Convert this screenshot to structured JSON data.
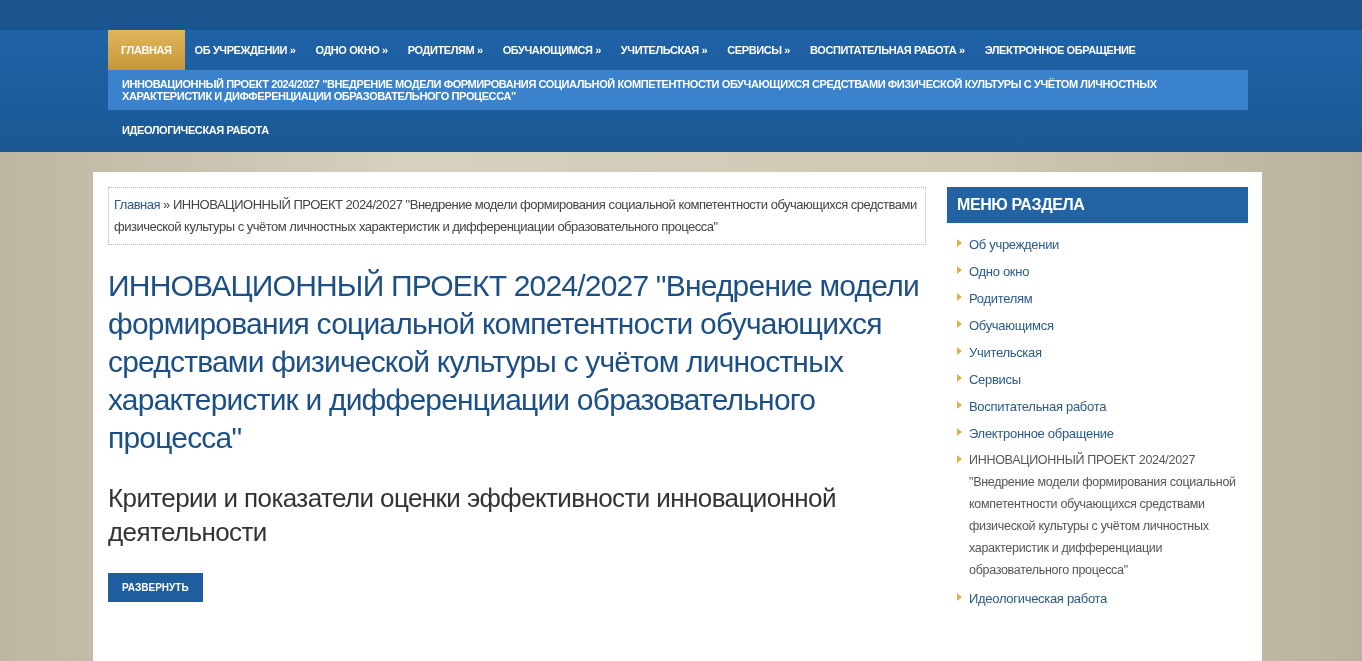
{
  "nav": {
    "items": [
      {
        "label": "ГЛАВНАЯ",
        "selected": true,
        "current": false
      },
      {
        "label": "ОБ УЧРЕЖДЕНИИ »",
        "selected": false,
        "current": false
      },
      {
        "label": "ОДНО ОКНО »",
        "selected": false,
        "current": false
      },
      {
        "label": "РОДИТЕЛЯМ »",
        "selected": false,
        "current": false
      },
      {
        "label": "ОБУЧАЮЩИМСЯ »",
        "selected": false,
        "current": false
      },
      {
        "label": "УЧИТЕЛЬСКАЯ »",
        "selected": false,
        "current": false
      },
      {
        "label": "СЕРВИСЫ »",
        "selected": false,
        "current": false
      },
      {
        "label": "ВОСПИТАТЕЛЬНАЯ РАБОТА »",
        "selected": false,
        "current": false
      },
      {
        "label": "ЭЛЕКТРОННОЕ ОБРАЩЕНИЕ",
        "selected": false,
        "current": false
      },
      {
        "label": "ИННОВАЦИОННЫЙ ПРОЕКТ 2024/2027 \"ВНЕДРЕНИЕ МОДЕЛИ ФОРМИРОВАНИЯ СОЦИАЛЬНОЙ КОМПЕТЕНТНОСТИ ОБУЧАЮЩИХСЯ СРЕДСТВАМИ ФИЗИЧЕСКОЙ КУЛЬТУРЫ С УЧЁТОМ ЛИЧНОСТНЫХ ХАРАКТЕРИСТИК И ДИФФЕРЕНЦИАЦИИ ОБРАЗОВАТЕЛЬНОГО ПРОЦЕССА\"",
        "selected": false,
        "current": true
      },
      {
        "label": "ИДЕОЛОГИЧЕСКАЯ РАБОТА",
        "selected": false,
        "current": false
      }
    ]
  },
  "breadcrumb": {
    "link": "Главная",
    "separator": "»",
    "current": "ИННОВАЦИОННЫЙ ПРОЕКТ 2024/2027 \"Внедрение модели формирования социальной компетентности обучающихся средствами физической культуры с учётом личностных характеристик и дифференциации образовательного процесса\""
  },
  "page_title": "ИННОВАЦИОННЫЙ ПРОЕКТ 2024/2027 \"Внедрение модели формирования социальной компетентности обучающихся средствами физической культуры с учётом личностных характеристик и дифференциации образовательного процесса\"",
  "section_heading": "Критерии и показатели оценки эффективности инновационной деятельности",
  "expand_button": "РАЗВЕРНУТЬ",
  "sidebar": {
    "title": "МЕНЮ РАЗДЕЛА",
    "items": [
      {
        "label": "Об учреждении",
        "current": false
      },
      {
        "label": "Одно окно",
        "current": false
      },
      {
        "label": "Родителям",
        "current": false
      },
      {
        "label": "Обучающимся",
        "current": false
      },
      {
        "label": "Учительская",
        "current": false
      },
      {
        "label": "Сервисы",
        "current": false
      },
      {
        "label": "Воспитательная работа",
        "current": false
      },
      {
        "label": "Электронное обращение",
        "current": false
      },
      {
        "label": "ИННОВАЦИОННЫЙ ПРОЕКТ 2024/2027 \"Внедрение модели формирования социальной компетентности обучающихся средствами физической культуры с учётом личностных характеристик и дифференциации образовательного процесса\"",
        "current": true
      },
      {
        "label": "Идеологическая работа",
        "current": false
      }
    ]
  }
}
